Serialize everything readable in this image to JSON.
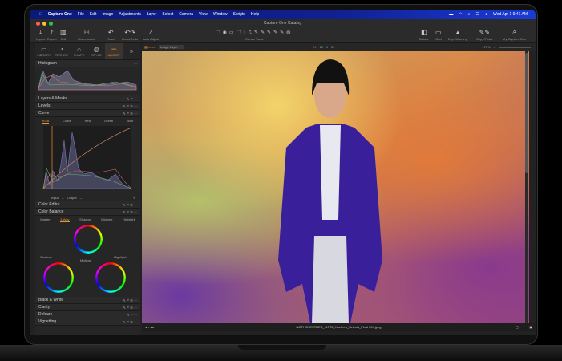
{
  "menubar": {
    "items": [
      "Capture One",
      "File",
      "Edit",
      "Image",
      "Adjustments",
      "Layer",
      "Select",
      "Camera",
      "View",
      "Window",
      "Scripts",
      "Help"
    ],
    "clock": "Wed Apr 1  9:41 AM"
  },
  "window": {
    "title": "Capture One Catalog"
  },
  "toolbar": {
    "import": "Import",
    "export": "Export",
    "cull": "Cull",
    "share": "Share online",
    "reset": "Reset",
    "undo": "Undo/Redo",
    "auto": "Auto Adjust",
    "cursor_tools": "Cursor Tools",
    "before": "Before",
    "grid": "Grid",
    "exp_warning": "Exp. Warning",
    "copy_paste": "Copy/Paste",
    "account": "My Capture One"
  },
  "tool_tabs": [
    {
      "label": "LIBRARY",
      "icon": "folder-icon"
    },
    {
      "label": "TETHER",
      "icon": "camera-icon"
    },
    {
      "label": "SHAPE",
      "icon": "crop-icon"
    },
    {
      "label": "STYLE",
      "icon": "palette-icon"
    },
    {
      "label": "ADJUST",
      "icon": "sliders-icon",
      "active": true
    }
  ],
  "panels": {
    "histogram": "Histogram",
    "layers": "Layers & Masks",
    "levels": "Levels",
    "curve": "Curve",
    "curve_tabs": [
      "RGB",
      "Luma",
      "Red",
      "Green",
      "Blue"
    ],
    "curve_input": "Input",
    "curve_output": "Output",
    "curve_dash": "--",
    "color_editor": "Color Editor",
    "color_balance": "Color Balance",
    "cb_tabs": [
      "Master",
      "3-Way",
      "Shadow",
      "Midtone",
      "Highlight"
    ],
    "wheel_shadow": "Shadow",
    "wheel_midtone": "Midtone",
    "wheel_highlight": "Highlight",
    "black_white": "Black & White",
    "clarity": "Clarity",
    "dehaze": "Dehaze",
    "vignetting": "Vignetting"
  },
  "viewer": {
    "layer": "Image Layer",
    "readout": [
      "24",
      "22",
      "6",
      "21"
    ],
    "zoom": "176%",
    "filename": "NOTHSHESTRES_11725_Hochreu_Selects_Final 004.jpeg"
  },
  "colors": {
    "accent": "#e8913a",
    "menubar": "#10208f"
  }
}
